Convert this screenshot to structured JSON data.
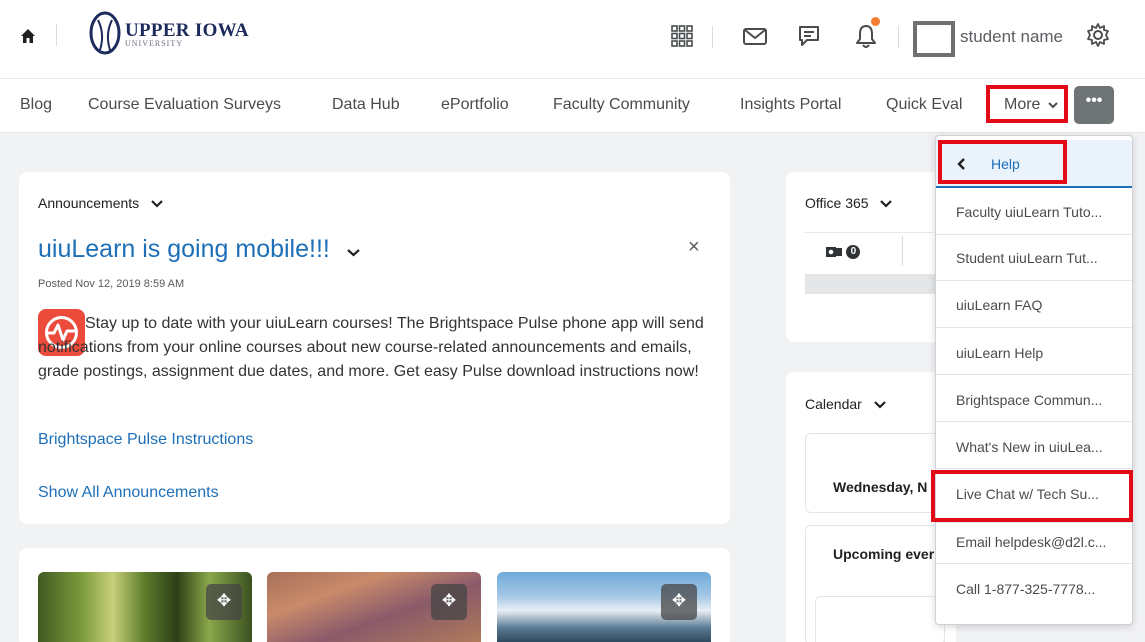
{
  "header": {
    "logo_title": "UPPER IOWA",
    "logo_subtitle": "UNIVERSITY",
    "username": "student name",
    "icons": [
      "home-icon",
      "apps-grid-icon",
      "mail-icon",
      "chat-icon",
      "bell-icon",
      "gear-icon"
    ],
    "notification_dot_color": "#f47d30"
  },
  "nav": {
    "items": [
      "Blog",
      "Course Evaluation Surveys",
      "Data Hub",
      "ePortfolio",
      "Faculty Community",
      "Insights Portal",
      "Quick Eval"
    ],
    "more_label": "More",
    "dots_label": "•••"
  },
  "announcements": {
    "header": "Announcements",
    "title": "uiuLearn is going mobile!!!",
    "posted": "Posted Nov 12, 2019 8:59 AM",
    "body": "Stay up to date with your uiuLearn courses! The Brightspace Pulse phone app will send notifications from your online courses about new course-related announcements and emails, grade postings, assignment due dates, and more. Get easy Pulse download instructions now!",
    "link": "Brightspace Pulse Instructions",
    "show_all": "Show All Announcements",
    "close": "×"
  },
  "office365": {
    "header": "Office 365",
    "count": "0"
  },
  "calendar": {
    "header": "Calendar",
    "day": "Wednesday, N",
    "upcoming": "Upcoming ever"
  },
  "dropdown": {
    "back_label": "Help",
    "items": [
      "Faculty uiuLearn Tuto...",
      "Student uiuLearn Tut...",
      "uiuLearn FAQ",
      "uiuLearn Help",
      "Brightspace Commun...",
      "What's New in uiuLea...",
      "Live Chat w/ Tech Su...",
      "Email helpdesk@d2l.c...",
      "Call 1-877-325-7778..."
    ]
  },
  "colors": {
    "link": "#1d6fb8",
    "highlight": "#e30b17",
    "background": "#f1f2f4"
  }
}
